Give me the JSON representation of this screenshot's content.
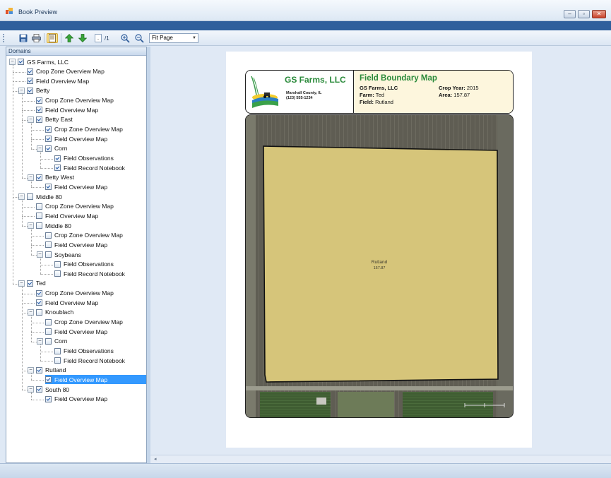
{
  "window": {
    "title": "Book Preview",
    "buttons": {
      "minimize": "–",
      "restore": "▫",
      "close": "✕"
    }
  },
  "toolbar": {
    "page_input": ".",
    "page_total": "/1",
    "zoom_select": "Fit Page",
    "icons": [
      "save-icon",
      "print-icon",
      "page-setup-icon",
      "prev-page-icon",
      "next-page-icon",
      "zoom-in-icon",
      "zoom-out-icon"
    ]
  },
  "tree": {
    "header": "Domains",
    "nodes": [
      {
        "label": "GS Farms, LLC",
        "level": 0,
        "expander": "minus",
        "checked": true
      },
      {
        "label": "Crop Zone Overview Map",
        "level": 1,
        "checked": true
      },
      {
        "label": "Field Overview Map",
        "level": 1,
        "checked": true
      },
      {
        "label": "Betty",
        "level": 1,
        "expander": "minus",
        "checked": true
      },
      {
        "label": "Crop Zone Overview Map",
        "level": 2,
        "checked": true
      },
      {
        "label": "Field Overview Map",
        "level": 2,
        "checked": true
      },
      {
        "label": "Betty East",
        "level": 2,
        "expander": "minus",
        "checked": true
      },
      {
        "label": "Crop Zone Overview Map",
        "level": 3,
        "checked": true
      },
      {
        "label": "Field Overview Map",
        "level": 3,
        "checked": true
      },
      {
        "label": "Corn",
        "level": 3,
        "expander": "minus",
        "checked": true
      },
      {
        "label": "Field Observations",
        "level": 4,
        "checked": true
      },
      {
        "label": "Field Record Notebook",
        "level": 4,
        "checked": true
      },
      {
        "label": "Betty West",
        "level": 2,
        "expander": "minus",
        "checked": true
      },
      {
        "label": "Field Overview Map",
        "level": 3,
        "checked": true
      },
      {
        "label": "Middle 80",
        "level": 1,
        "expander": "minus",
        "checked": false
      },
      {
        "label": "Crop Zone Overview Map",
        "level": 2,
        "checked": false
      },
      {
        "label": "Field Overview Map",
        "level": 2,
        "checked": false
      },
      {
        "label": "Middle 80",
        "level": 2,
        "expander": "minus",
        "checked": false
      },
      {
        "label": "Crop Zone Overview Map",
        "level": 3,
        "checked": false
      },
      {
        "label": "Field Overview Map",
        "level": 3,
        "checked": false
      },
      {
        "label": "Soybeans",
        "level": 3,
        "expander": "minus",
        "checked": false
      },
      {
        "label": "Field Observations",
        "level": 4,
        "checked": false
      },
      {
        "label": "Field Record Notebook",
        "level": 4,
        "checked": false
      },
      {
        "label": "Ted",
        "level": 1,
        "expander": "minus",
        "checked": true
      },
      {
        "label": "Crop Zone Overview Map",
        "level": 2,
        "checked": true
      },
      {
        "label": "Field Overview Map",
        "level": 2,
        "checked": true
      },
      {
        "label": "Knoublach",
        "level": 2,
        "expander": "minus",
        "checked": false
      },
      {
        "label": "Crop Zone Overview Map",
        "level": 3,
        "checked": false
      },
      {
        "label": "Field Overview Map",
        "level": 3,
        "checked": false
      },
      {
        "label": "Corn",
        "level": 3,
        "expander": "minus",
        "checked": false
      },
      {
        "label": "Field Observations",
        "level": 4,
        "checked": false
      },
      {
        "label": "Field Record Notebook",
        "level": 4,
        "checked": false
      },
      {
        "label": "Rutland",
        "level": 2,
        "expander": "minus",
        "checked": true
      },
      {
        "label": "Field Overview Map",
        "level": 3,
        "checked": true,
        "selected": true
      },
      {
        "label": "South 80",
        "level": 2,
        "expander": "minus",
        "checked": true
      },
      {
        "label": "Field Overview Map",
        "level": 3,
        "checked": true
      }
    ]
  },
  "report": {
    "company_name": "GS Farms, LLC",
    "company_location": "Marshall County, IL",
    "company_phone": "(123) 555-1234",
    "map_title": "Field Boundary Map",
    "company_line": "GS Farms, LLC",
    "farm_label": "Farm:",
    "farm_value": "Ted",
    "field_label": "Field:",
    "field_value": "Rutland",
    "crop_year_label": "Crop Year:",
    "crop_year_value": "2015",
    "area_label": "Area:",
    "area_value": "157.87",
    "map_field_name": "Rutland",
    "map_field_area": "157.87"
  },
  "colors": {
    "field_fill": "#d6c57a",
    "title_green": "#2a8a3a",
    "header_fill": "#fdf6dd",
    "selection": "#3399ff"
  }
}
